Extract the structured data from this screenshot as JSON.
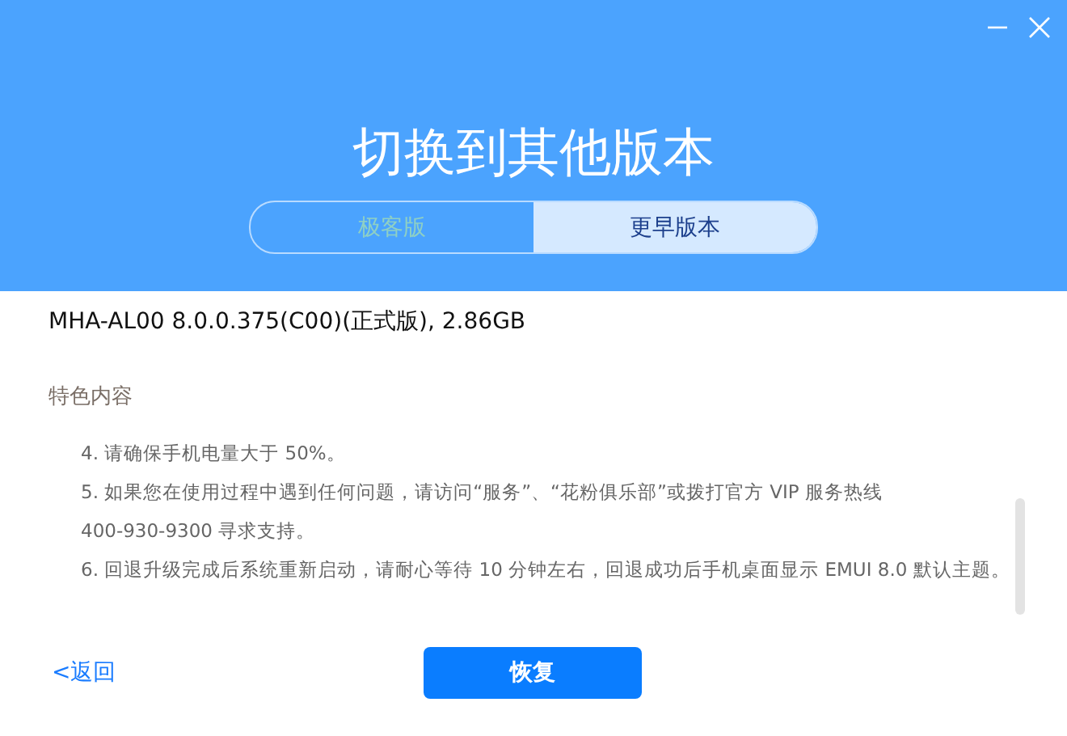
{
  "window": {
    "title": "切换到其他版本"
  },
  "tabs": [
    {
      "label": "极客版",
      "selected": false
    },
    {
      "label": "更早版本",
      "selected": true
    }
  ],
  "version": "MHA-AL00 8.0.0.375(C00)(正式版), 2.86GB",
  "features": {
    "heading": "特色内容",
    "items": [
      "4. 请确保手机电量大于 50%。",
      "5. 如果您在使用过程中遇到任何问题，请访问“服务”、“花粉俱乐部”或拨打官方 VIP 服务热线",
      "400-930-9300 寻求支持。",
      "6. 回退升级完成后系统重新启动，请耐心等待 10 分钟左右，回退成功后手机桌面显示 EMUI 8.0 默认主题。"
    ]
  },
  "back_link": "<返回",
  "restore_button": "恢复"
}
